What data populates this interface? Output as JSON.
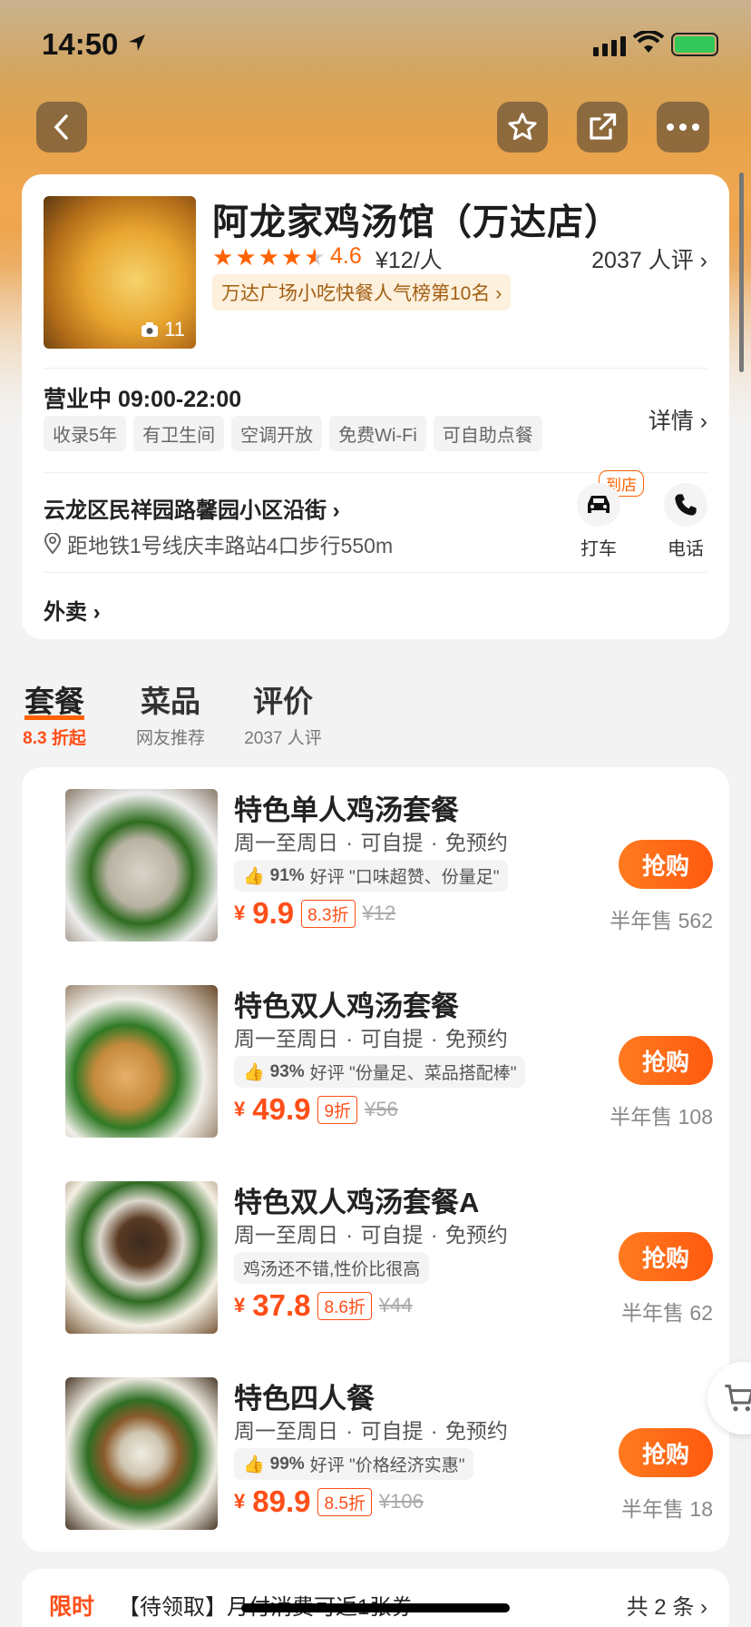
{
  "status_bar": {
    "time": "14:50"
  },
  "shop": {
    "name": "阿龙家鸡汤馆（万达店）",
    "rating": "4.6",
    "price": "¥12/人",
    "reviews": "2037 人评",
    "rank": "万达广场小吃快餐人气榜第10名",
    "photo_count": "11",
    "hours": "营业中 09:00-22:00",
    "tags": [
      "收录5年",
      "有卫生间",
      "空调开放",
      "免费Wi-Fi",
      "可自助点餐"
    ],
    "detail_label": "详情",
    "address": "云龙区民祥园路馨园小区沿街",
    "metro": "距地铁1号线庆丰路站4口步行550m",
    "taxi_label": "打车",
    "phone_label": "电话",
    "daodian_label": "到店",
    "waimai_label": "外卖"
  },
  "tabs": [
    {
      "title": "套餐",
      "sub": "8.3 折起"
    },
    {
      "title": "菜品",
      "sub": "网友推荐"
    },
    {
      "title": "评价",
      "sub": "2037 人评"
    }
  ],
  "deals": [
    {
      "name": "特色单人鸡汤套餐",
      "meta": "周一至周日 · 可自提 · 免预约",
      "pct": "91%",
      "quote_rest": "好评 \"口味超赞、份量足\"",
      "quote": "",
      "price": "9.9",
      "discount": "8.3折",
      "orig": "12",
      "buy": "抢购",
      "sold": "半年售 562"
    },
    {
      "name": "特色双人鸡汤套餐",
      "meta": "周一至周日 · 可自提 · 免预约",
      "pct": "93%",
      "quote_rest": "好评 \"份量足、菜品搭配棒\"",
      "quote": "",
      "price": "49.9",
      "discount": "9折",
      "orig": "56",
      "buy": "抢购",
      "sold": "半年售 108"
    },
    {
      "name": "特色双人鸡汤套餐A",
      "meta": "周一至周日 · 可自提 · 免预约",
      "pct": "",
      "quote_rest": "",
      "quote": "鸡汤还不错,性价比很高",
      "price": "37.8",
      "discount": "8.6折",
      "orig": "44",
      "buy": "抢购",
      "sold": "半年售 62"
    },
    {
      "name": "特色四人餐",
      "meta": "周一至周日 · 可自提 · 免预约",
      "pct": "99%",
      "quote_rest": "好评 \"价格经济实惠\"",
      "quote": "",
      "price": "89.9",
      "discount": "8.5折",
      "orig": "106",
      "buy": "抢购",
      "sold": "半年售 18"
    }
  ],
  "promo": {
    "tag": "限时",
    "text": "【待领取】月付消费可返1张券",
    "total": "共 2 条"
  },
  "colors": {
    "accent": "#ff4e17",
    "star": "#ff6200"
  }
}
